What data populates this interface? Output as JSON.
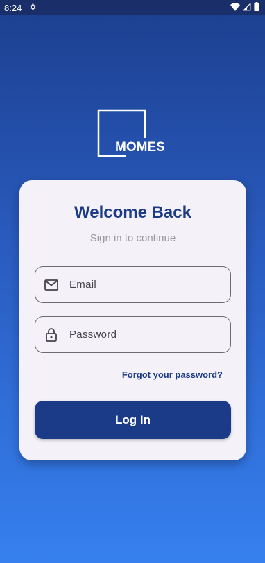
{
  "status_bar": {
    "time": "8:24",
    "icons": [
      "settings-icon",
      "wifi-icon",
      "signal-icon",
      "battery-icon"
    ]
  },
  "brand": {
    "logo_text": "MOMES"
  },
  "login": {
    "title": "Welcome Back",
    "subtitle": "Sign in to continue",
    "email_placeholder": "Email",
    "password_placeholder": "Password",
    "forgot_label": "Forgot your password?",
    "login_label": "Log In"
  },
  "colors": {
    "primary": "#1b3a87",
    "card_bg": "#f5f1f8",
    "gradient_top": "#1c3f8f",
    "gradient_bottom": "#3680ef"
  }
}
